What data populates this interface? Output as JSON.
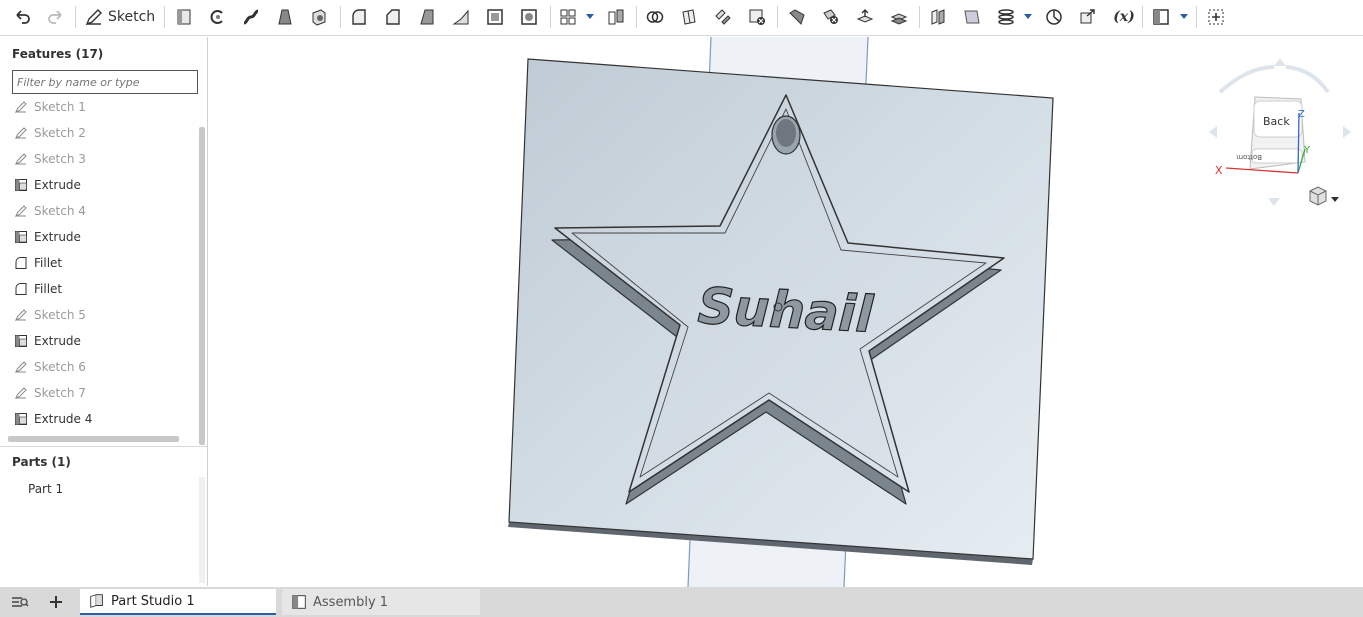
{
  "toolbar": {
    "sketch_label": "Sketch",
    "variable_label": "(x)"
  },
  "feature_panel": {
    "title": "Features (17)",
    "filter_placeholder": "Filter by name or type",
    "items": [
      {
        "label": "Sketch 1",
        "type": "sketch"
      },
      {
        "label": "Sketch 2",
        "type": "sketch"
      },
      {
        "label": "Sketch 3",
        "type": "sketch"
      },
      {
        "label": "Extrude",
        "type": "extrude"
      },
      {
        "label": "Sketch 4",
        "type": "sketch"
      },
      {
        "label": "Extrude",
        "type": "extrude"
      },
      {
        "label": "Fillet",
        "type": "fillet"
      },
      {
        "label": "Fillet",
        "type": "fillet"
      },
      {
        "label": "Sketch 5",
        "type": "sketch"
      },
      {
        "label": "Extrude",
        "type": "extrude"
      },
      {
        "label": "Sketch 6",
        "type": "sketch"
      },
      {
        "label": "Sketch 7",
        "type": "sketch"
      },
      {
        "label": "Extrude 4",
        "type": "extrude"
      }
    ]
  },
  "parts_panel": {
    "title": "Parts (1)",
    "items": [
      "Part 1"
    ]
  },
  "viewport": {
    "model_text": "Suhail"
  },
  "view_cube": {
    "front_face": "Back",
    "bottom_face": "Bottom",
    "axis_x": "X",
    "axis_y": "Y",
    "axis_z": "Z"
  },
  "tabs": [
    {
      "label": "Part Studio 1",
      "active": true
    },
    {
      "label": "Assembly 1",
      "active": false
    }
  ],
  "colors": {
    "accent": "#2a5fa8",
    "plane": "#c9d5df",
    "model": "#c0c9d1"
  }
}
